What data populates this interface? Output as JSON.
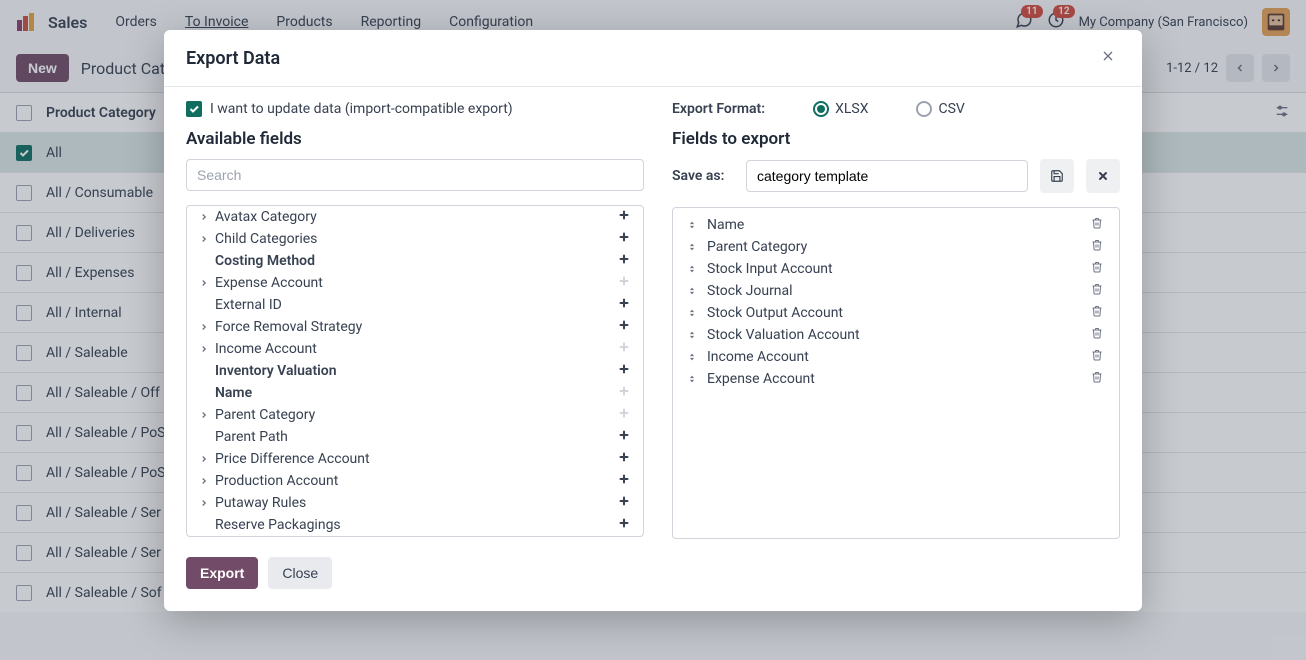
{
  "topbar": {
    "brand": "Sales",
    "nav": [
      "Orders",
      "To Invoice",
      "Products",
      "Reporting",
      "Configuration"
    ],
    "msg_badge": "11",
    "activity_badge": "12",
    "company": "My Company (San Francisco)"
  },
  "subbar": {
    "new_label": "New",
    "title": "Product Cat",
    "pager": "1-12 / 12"
  },
  "list": {
    "header": "Product Category",
    "rows": [
      {
        "label": "All",
        "checked": true
      },
      {
        "label": "All / Consumable",
        "checked": false
      },
      {
        "label": "All / Deliveries",
        "checked": false
      },
      {
        "label": "All / Expenses",
        "checked": false
      },
      {
        "label": "All / Internal",
        "checked": false
      },
      {
        "label": "All / Saleable",
        "checked": false
      },
      {
        "label": "All / Saleable / Off",
        "checked": false
      },
      {
        "label": "All / Saleable / PoS",
        "checked": false
      },
      {
        "label": "All / Saleable / PoS",
        "checked": false
      },
      {
        "label": "All / Saleable / Ser",
        "checked": false
      },
      {
        "label": "All / Saleable / Ser",
        "checked": false
      },
      {
        "label": "All / Saleable / Sof",
        "checked": false
      }
    ]
  },
  "modal": {
    "title": "Export Data",
    "import_compat_label": "I want to update data (import-compatible export)",
    "available_fields_title": "Available fields",
    "search_placeholder": "Search",
    "available": [
      {
        "label": "Avatax Category",
        "expandable": true,
        "bold": false,
        "add": true
      },
      {
        "label": "Child Categories",
        "expandable": true,
        "bold": false,
        "add": true
      },
      {
        "label": "Costing Method",
        "expandable": false,
        "bold": true,
        "add": true
      },
      {
        "label": "Expense Account",
        "expandable": true,
        "bold": false,
        "add": false
      },
      {
        "label": "External ID",
        "expandable": false,
        "bold": false,
        "add": true
      },
      {
        "label": "Force Removal Strategy",
        "expandable": true,
        "bold": false,
        "add": true
      },
      {
        "label": "Income Account",
        "expandable": true,
        "bold": false,
        "add": false
      },
      {
        "label": "Inventory Valuation",
        "expandable": false,
        "bold": true,
        "add": true
      },
      {
        "label": "Name",
        "expandable": false,
        "bold": true,
        "add": false
      },
      {
        "label": "Parent Category",
        "expandable": true,
        "bold": false,
        "add": false
      },
      {
        "label": "Parent Path",
        "expandable": false,
        "bold": false,
        "add": true
      },
      {
        "label": "Price Difference Account",
        "expandable": true,
        "bold": false,
        "add": true
      },
      {
        "label": "Production Account",
        "expandable": true,
        "bold": false,
        "add": true
      },
      {
        "label": "Putaway Rules",
        "expandable": true,
        "bold": false,
        "add": true
      },
      {
        "label": "Reserve Packagings",
        "expandable": false,
        "bold": false,
        "add": true
      }
    ],
    "export_format_label": "Export Format:",
    "format_xlsx": "XLSX",
    "format_csv": "CSV",
    "fields_to_export_title": "Fields to export",
    "saveas_label": "Save as:",
    "saveas_value": "category template",
    "export_fields": [
      "Name",
      "Parent Category",
      "Stock Input Account",
      "Stock Journal",
      "Stock Output Account",
      "Stock Valuation Account",
      "Income Account",
      "Expense Account"
    ],
    "export_btn": "Export",
    "close_btn": "Close"
  }
}
